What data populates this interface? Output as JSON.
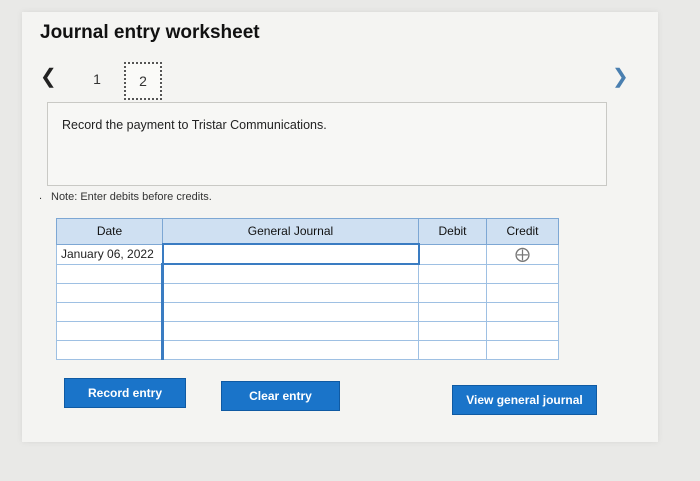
{
  "worksheet": {
    "title": "Journal entry worksheet",
    "nav": {
      "prev_icon": "chevron-left-icon",
      "next_icon": "chevron-right-icon"
    },
    "pages": [
      "1",
      "2"
    ],
    "current_page": "2",
    "prompt": "Record the payment to Tristar Communications.",
    "note_bullet": ".",
    "note": "Note: Enter debits before credits."
  },
  "table": {
    "headers": {
      "date": "Date",
      "general_journal": "General Journal",
      "debit": "Debit",
      "credit": "Credit"
    },
    "rows": [
      {
        "date": "January 06, 2022",
        "general_journal": "",
        "debit": "",
        "credit": ""
      },
      {
        "date": "",
        "general_journal": "",
        "debit": "",
        "credit": ""
      },
      {
        "date": "",
        "general_journal": "",
        "debit": "",
        "credit": ""
      },
      {
        "date": "",
        "general_journal": "",
        "debit": "",
        "credit": ""
      },
      {
        "date": "",
        "general_journal": "",
        "debit": "",
        "credit": ""
      },
      {
        "date": "",
        "general_journal": "",
        "debit": "",
        "credit": ""
      }
    ]
  },
  "buttons": {
    "record": "Record entry",
    "clear": "Clear entry",
    "view": "View general journal"
  },
  "colors": {
    "accent": "#1a74c9",
    "header_bg": "#cfe0f2"
  }
}
